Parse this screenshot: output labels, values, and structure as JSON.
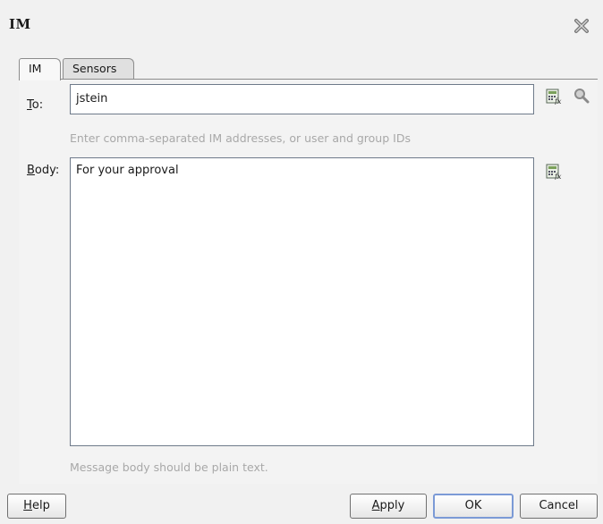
{
  "dialog": {
    "title": "IM"
  },
  "tabs": [
    {
      "label": "IM",
      "active": true
    },
    {
      "label": "Sensors",
      "active": false
    }
  ],
  "to": {
    "label_u": "T",
    "label_rest": "o:",
    "value": "jstein",
    "hint": "Enter comma-separated IM addresses, or user and group IDs"
  },
  "body": {
    "label_u": "B",
    "label_rest": "ody:",
    "value": "For your approval",
    "hint": "Message body should be plain text."
  },
  "buttons": {
    "help_u": "H",
    "help_rest": "elp",
    "apply_u": "A",
    "apply_rest": "pply",
    "ok": "OK",
    "cancel": "Cancel"
  },
  "icons": {
    "close": "close-icon",
    "expression_builder": "expression-builder-icon",
    "search": "search-icon"
  }
}
